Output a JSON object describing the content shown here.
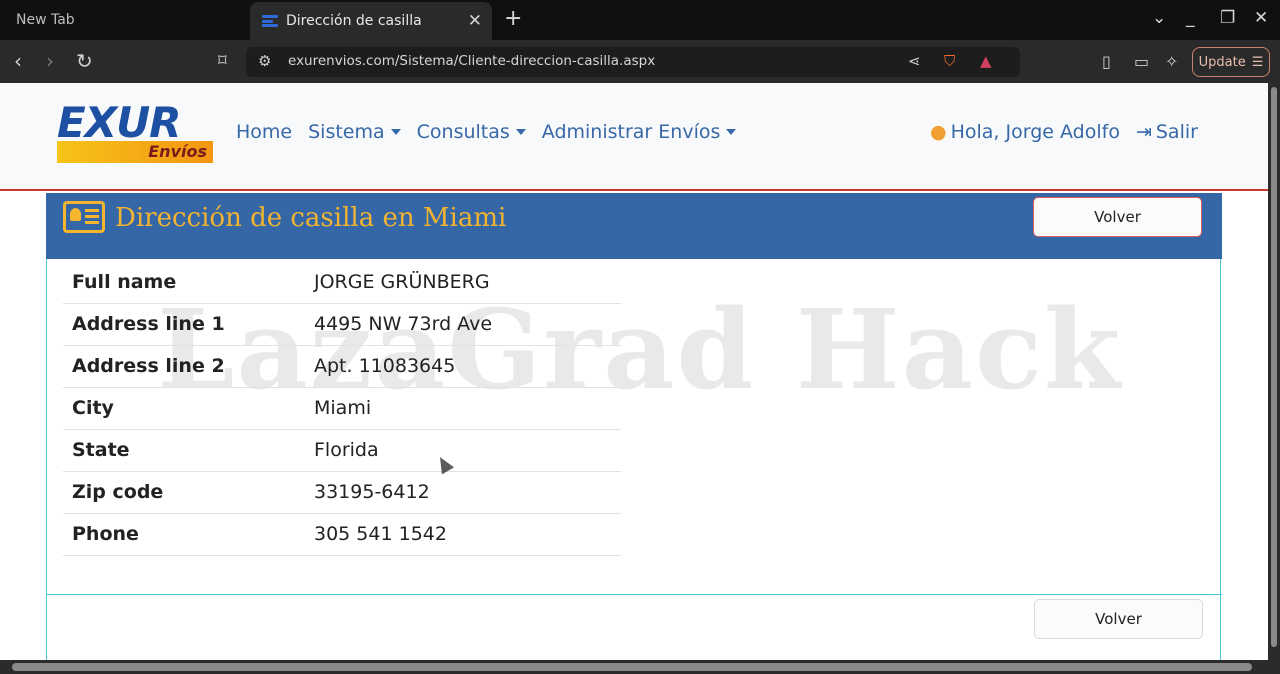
{
  "browser": {
    "inactive_tab": "New Tab",
    "active_tab": "Dirección de casilla",
    "url": "exurenvios.com/Sistema/Cliente-direccion-casilla.aspx",
    "update_label": "Update"
  },
  "logo": {
    "top": "EXUR",
    "sub": "Envíos"
  },
  "menu": {
    "home": "Home",
    "sistema": "Sistema",
    "consultas": "Consultas",
    "administrar": "Administrar Envíos"
  },
  "user": {
    "greeting": "Hola, Jorge Adolfo",
    "logout": "Salir"
  },
  "card": {
    "title": "Dirección de casilla en Miami",
    "back_label": "Volver",
    "rows": [
      {
        "label": "Full name",
        "value": "JORGE GRÜNBERG"
      },
      {
        "label": "Address line 1",
        "value": "4495 NW 73rd Ave"
      },
      {
        "label": "Address line 2",
        "value": "Apt. 11083645"
      },
      {
        "label": "City",
        "value": "Miami"
      },
      {
        "label": "State",
        "value": "Florida"
      },
      {
        "label": "Zip code",
        "value": "33195-6412"
      },
      {
        "label": "Phone",
        "value": "305 541 1542"
      }
    ]
  },
  "watermark": "LazaGrad Hack",
  "colors": {
    "header": "#3567a7",
    "title": "#f2b430",
    "link": "#3768a8",
    "accent": "#c0392b"
  }
}
